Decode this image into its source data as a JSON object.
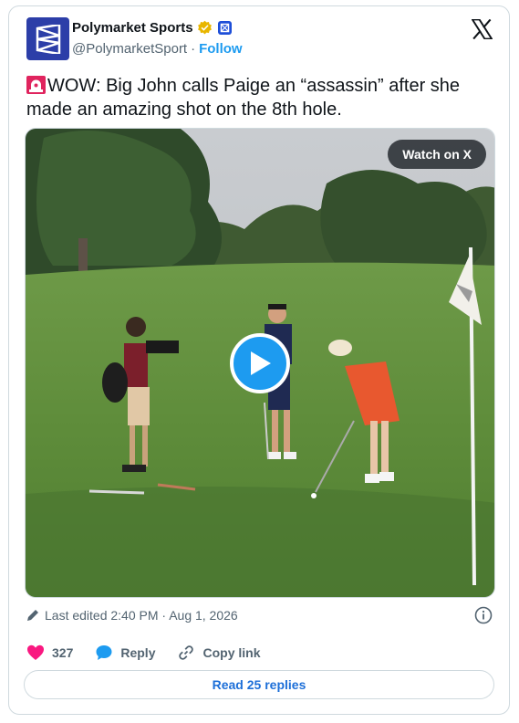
{
  "author": {
    "display_name": "Polymarket Sports",
    "handle": "@PolymarketSport",
    "separator": "·",
    "follow_label": "Follow"
  },
  "tweet": {
    "text": "WOW: Big John calls Paige an “assassin” after she made an amazing shot on the 8th hole."
  },
  "media": {
    "watch_label": "Watch on X"
  },
  "meta": {
    "edited_label": "Last edited 2:40 PM · Aug 1, 2026"
  },
  "actions": {
    "like_count": "327",
    "reply_label": "Reply",
    "copy_label": "Copy link"
  },
  "replies_button": "Read 25 replies",
  "colors": {
    "accent": "#1d9bf0",
    "like": "#f91880",
    "avatar_bg": "#2c3ea8",
    "verified": "#e8b600"
  },
  "icons": [
    "polymarket-logo-icon",
    "verified-badge-icon",
    "affiliate-badge-icon",
    "x-logo-icon",
    "siren-emoji-icon",
    "play-icon",
    "pencil-icon",
    "info-icon",
    "heart-icon",
    "reply-bubble-icon",
    "link-icon"
  ]
}
